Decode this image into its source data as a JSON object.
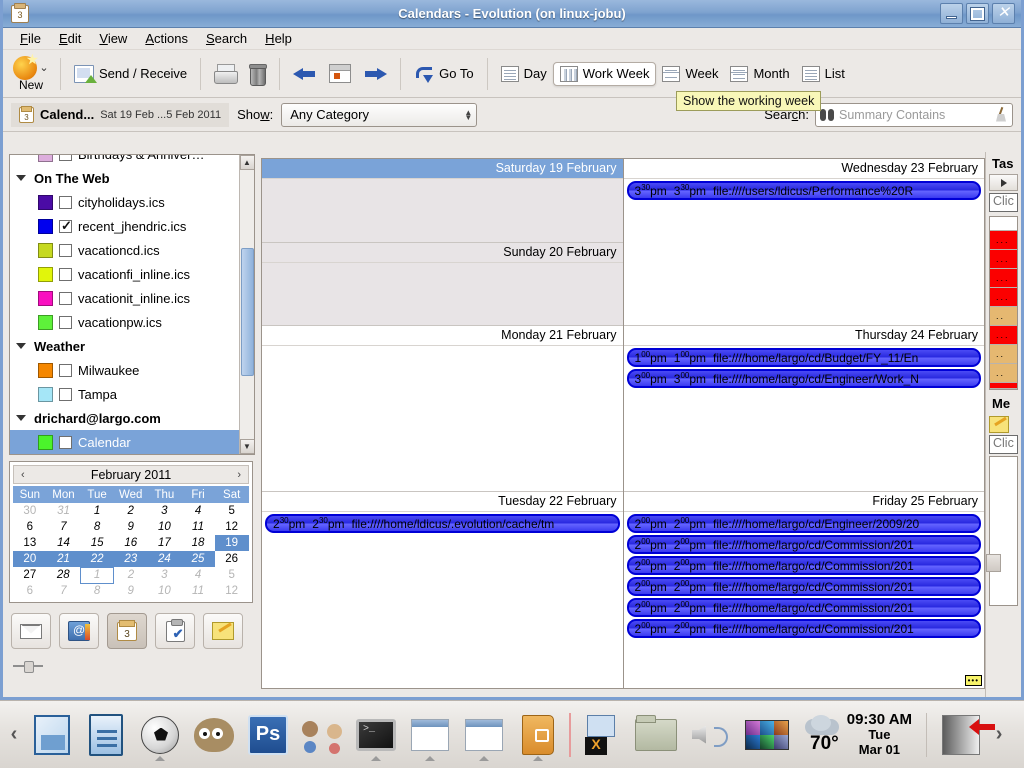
{
  "window": {
    "title": "Calendars - Evolution (on linux-jobu)",
    "icon": "calendar-icon",
    "buttons": {
      "minimize": "_",
      "maximize": "□",
      "close": "✕"
    }
  },
  "menu": [
    {
      "label": "File",
      "accel": "F"
    },
    {
      "label": "Edit",
      "accel": "E"
    },
    {
      "label": "View",
      "accel": "V"
    },
    {
      "label": "Actions",
      "accel": "A"
    },
    {
      "label": "Search",
      "accel": "S"
    },
    {
      "label": "Help",
      "accel": "H"
    }
  ],
  "toolbar": {
    "new_label": "New",
    "send_receive_label": "Send / Receive",
    "print_label": "print-icon",
    "delete_label": "trash-icon",
    "back_label": "previous-icon",
    "today_label": "today-icon",
    "forward_label": "next-icon",
    "goto_label": "Go To",
    "views": [
      {
        "label": "Day",
        "selected": false
      },
      {
        "label": "Work Week",
        "selected": true
      },
      {
        "label": "Week",
        "selected": false
      },
      {
        "label": "Month",
        "selected": false
      },
      {
        "label": "List",
        "selected": false
      }
    ],
    "tooltip": "Show the working week"
  },
  "filterbar": {
    "folder_name": "Calend...",
    "date_range": "Sat 19 Feb ...5 Feb 2011",
    "show_label": "Show:",
    "show_value": "Any Category",
    "search_label": "Search:",
    "search_value": "",
    "search_placeholder": "Summary Contains"
  },
  "sidebar": {
    "sources": [
      {
        "label": "Birthdays & Anniver…",
        "color": "#ddaedd",
        "checked": false,
        "type": "item",
        "partial": true
      },
      {
        "label": "On The Web",
        "type": "group"
      },
      {
        "label": "cityholidays.ics",
        "color": "#4b0ba5",
        "checked": false,
        "type": "item"
      },
      {
        "label": "recent_jhendric.ics",
        "color": "#0000ee",
        "checked": true,
        "type": "item"
      },
      {
        "label": "vacationcd.ics",
        "color": "#c6d920",
        "checked": false,
        "type": "item"
      },
      {
        "label": "vacationfi_inline.ics",
        "color": "#e1f50b",
        "checked": false,
        "type": "item"
      },
      {
        "label": "vacationit_inline.ics",
        "color": "#f910c0",
        "checked": false,
        "type": "item"
      },
      {
        "label": "vacationpw.ics",
        "color": "#5ef13a",
        "checked": false,
        "type": "item"
      },
      {
        "label": "Weather",
        "type": "group"
      },
      {
        "label": "Milwaukee",
        "color": "#f58700",
        "checked": false,
        "type": "item"
      },
      {
        "label": "Tampa",
        "color": "#a5e6f7",
        "checked": false,
        "type": "item"
      },
      {
        "label": "drichard@largo.com",
        "type": "group"
      },
      {
        "label": "Calendar",
        "color": "#4bf32b",
        "checked": false,
        "type": "item",
        "selected": true
      }
    ],
    "minicalendar": {
      "title": "February 2011",
      "prev": "‹",
      "next": "›",
      "weekdays": [
        "Sun",
        "Mon",
        "Tue",
        "Wed",
        "Thu",
        "Fri",
        "Sat"
      ],
      "weeks": [
        [
          {
            "d": "30",
            "dim": true
          },
          {
            "d": "31",
            "dim": true
          },
          {
            "d": "1"
          },
          {
            "d": "2"
          },
          {
            "d": "3"
          },
          {
            "d": "4"
          },
          {
            "d": "5"
          }
        ],
        [
          {
            "d": "6"
          },
          {
            "d": "7"
          },
          {
            "d": "8"
          },
          {
            "d": "9"
          },
          {
            "d": "10"
          },
          {
            "d": "11"
          },
          {
            "d": "12"
          }
        ],
        [
          {
            "d": "13"
          },
          {
            "d": "14"
          },
          {
            "d": "15"
          },
          {
            "d": "16"
          },
          {
            "d": "17"
          },
          {
            "d": "18"
          },
          {
            "d": "19",
            "sel": true
          }
        ],
        [
          {
            "d": "20",
            "sel": true
          },
          {
            "d": "21",
            "sel": true
          },
          {
            "d": "22",
            "sel": true
          },
          {
            "d": "23",
            "sel": true
          },
          {
            "d": "24",
            "sel": true
          },
          {
            "d": "25",
            "sel": true
          },
          {
            "d": "26"
          }
        ],
        [
          {
            "d": "27"
          },
          {
            "d": "28"
          },
          {
            "d": "1",
            "dim": true,
            "today": true
          },
          {
            "d": "2",
            "dim": true
          },
          {
            "d": "3",
            "dim": true
          },
          {
            "d": "4",
            "dim": true
          },
          {
            "d": "5",
            "dim": true
          }
        ],
        [
          {
            "d": "6",
            "dim": true
          },
          {
            "d": "7",
            "dim": true
          },
          {
            "d": "8",
            "dim": true
          },
          {
            "d": "9",
            "dim": true
          },
          {
            "d": "10",
            "dim": true
          },
          {
            "d": "11",
            "dim": true
          },
          {
            "d": "12",
            "dim": true
          }
        ]
      ]
    },
    "shortcuts": [
      {
        "name": "mail-shortcut",
        "icon": "mail-icon",
        "active": false
      },
      {
        "name": "contacts-shortcut",
        "icon": "contacts-icon",
        "active": false
      },
      {
        "name": "calendar-shortcut",
        "icon": "calendar-icon",
        "active": true
      },
      {
        "name": "tasks-shortcut",
        "icon": "tasks-icon",
        "active": false
      },
      {
        "name": "memos-shortcut",
        "icon": "memo-icon",
        "active": false
      }
    ]
  },
  "calendar": {
    "days": [
      {
        "title": "Saturday 19 February",
        "weekend": true,
        "selected": true,
        "column": "left",
        "events": []
      },
      {
        "title": "Sunday 20 February",
        "weekend": true,
        "selected": false,
        "column": "left",
        "events": []
      },
      {
        "title": "Monday 21 February",
        "weekend": false,
        "selected": false,
        "column": "left",
        "events": []
      },
      {
        "title": "Tuesday 22 February",
        "weekend": false,
        "selected": false,
        "column": "left",
        "events": [
          {
            "start": "2",
            "start_min": "30",
            "start_ampm": "pm",
            "end": "2",
            "end_min": "30",
            "end_ampm": "pm",
            "summary": "file:////home/ldicus/.evolution/cache/tm"
          }
        ]
      },
      {
        "title": "Wednesday 23 February",
        "weekend": false,
        "selected": false,
        "column": "right",
        "events": [
          {
            "start": "3",
            "start_min": "30",
            "start_ampm": "pm",
            "end": "3",
            "end_min": "30",
            "end_ampm": "pm",
            "summary": "file:////users/ldicus/Performance%20R"
          }
        ]
      },
      {
        "title": "Thursday 24 February",
        "weekend": false,
        "selected": false,
        "column": "right",
        "events": [
          {
            "start": "1",
            "start_min": "00",
            "start_ampm": "pm",
            "end": "1",
            "end_min": "00",
            "end_ampm": "pm",
            "summary": "file:////home/largo/cd/Budget/FY_11/En"
          },
          {
            "start": "3",
            "start_min": "00",
            "start_ampm": "pm",
            "end": "3",
            "end_min": "00",
            "end_ampm": "pm",
            "summary": "file:////home/largo/cd/Engineer/Work_N"
          }
        ]
      },
      {
        "title": "Friday 25 February",
        "weekend": false,
        "selected": false,
        "column": "right",
        "events": [
          {
            "start": "2",
            "start_min": "00",
            "start_ampm": "pm",
            "end": "2",
            "end_min": "00",
            "end_ampm": "pm",
            "summary": "file:////home/largo/cd/Engineer/2009/20"
          },
          {
            "start": "2",
            "start_min": "00",
            "start_ampm": "pm",
            "end": "2",
            "end_min": "00",
            "end_ampm": "pm",
            "summary": "file:////home/largo/cd/Commission/201"
          },
          {
            "start": "2",
            "start_min": "00",
            "start_ampm": "pm",
            "end": "2",
            "end_min": "00",
            "end_ampm": "pm",
            "summary": "file:////home/largo/cd/Commission/201"
          },
          {
            "start": "2",
            "start_min": "00",
            "start_ampm": "pm",
            "end": "2",
            "end_min": "00",
            "end_ampm": "pm",
            "summary": "file:////home/largo/cd/Commission/201"
          },
          {
            "start": "2",
            "start_min": "00",
            "start_ampm": "pm",
            "end": "2",
            "end_min": "00",
            "end_ampm": "pm",
            "summary": "file:////home/largo/cd/Commission/201"
          },
          {
            "start": "2",
            "start_min": "00",
            "start_ampm": "pm",
            "end": "2",
            "end_min": "00",
            "end_ampm": "pm",
            "summary": "file:////home/largo/cd/Commission/201"
          }
        ],
        "overflow_badge": "•••"
      }
    ]
  },
  "rightpane": {
    "tasks_title": "Tas",
    "tasks_click": "Clic",
    "memos_title": "Me",
    "memos_click": "Clic",
    "task_rows": [
      {
        "style": "red",
        "text": "..."
      },
      {
        "style": "red",
        "text": "..."
      },
      {
        "style": "red",
        "text": "..."
      },
      {
        "style": "red",
        "text": "..."
      },
      {
        "style": "tan",
        "text": ".."
      },
      {
        "style": "red",
        "text": "..."
      },
      {
        "style": "tan",
        "text": ".."
      },
      {
        "style": "tan",
        "text": ".."
      },
      {
        "style": "red",
        "text": ""
      }
    ]
  },
  "taskbar": {
    "left_arrow": "‹",
    "right_arrow": "›",
    "items": [
      {
        "name": "libreoffice-impress-icon"
      },
      {
        "name": "libreoffice-writer-icon"
      },
      {
        "name": "football-icon"
      },
      {
        "name": "gimp-icon"
      },
      {
        "name": "photoshop-icon"
      },
      {
        "name": "users-icon"
      },
      {
        "name": "terminal-icon"
      },
      {
        "name": "window-icon"
      },
      {
        "name": "window-2-icon"
      },
      {
        "name": "address-book-icon"
      },
      {
        "name": "mail-chat-icon"
      },
      {
        "name": "folder-icon"
      },
      {
        "name": "volume-icon"
      },
      {
        "name": "photos-icon"
      },
      {
        "name": "weather-icon"
      },
      {
        "name": "logout-icon"
      }
    ],
    "clock": {
      "time": "09:30 AM",
      "weekday": "Tue",
      "date": "Mar 01"
    },
    "weather": {
      "temp": "70",
      "unit": "°"
    }
  },
  "colors": {
    "titlebar_blue": "#7fa3cf",
    "selection_blue": "#7aa3d8",
    "event_blue": "#2a2ae0",
    "weekend_bg": "#e8e4e6",
    "tooltip_bg": "#f8f7b8"
  }
}
